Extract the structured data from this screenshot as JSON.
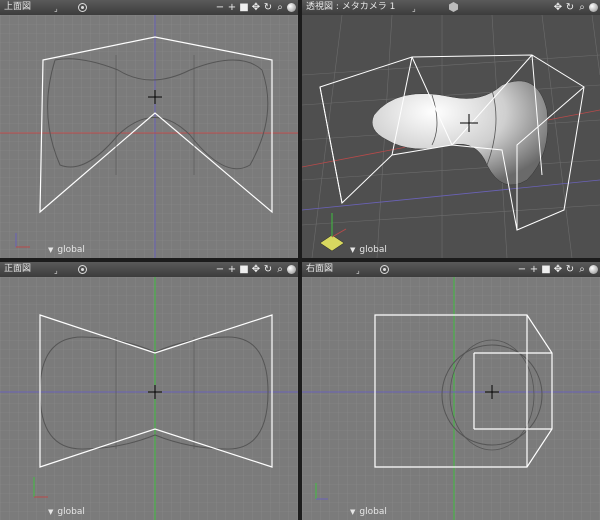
{
  "viewports": {
    "top_left": {
      "title": "上面図"
    },
    "top_right": {
      "title": "透視図 : メタカメラ 1"
    },
    "bottom_left": {
      "title": "正面図"
    },
    "bottom_right": {
      "title": "右面図"
    }
  },
  "toolbar": {
    "dropdown_glyph": "⌟"
  },
  "coord_system": {
    "label": "global",
    "arrow": "▼"
  },
  "colors": {
    "grid_bg": "#7b7b7b",
    "grid_line": "#8d8d8d",
    "grid_major": "#9a9a9a",
    "axis_x": "#6a62b8",
    "axis_y": "#3fbf3f",
    "axis_red": "#b84a4a",
    "wire": "#ffffff",
    "curve": "#555555"
  }
}
